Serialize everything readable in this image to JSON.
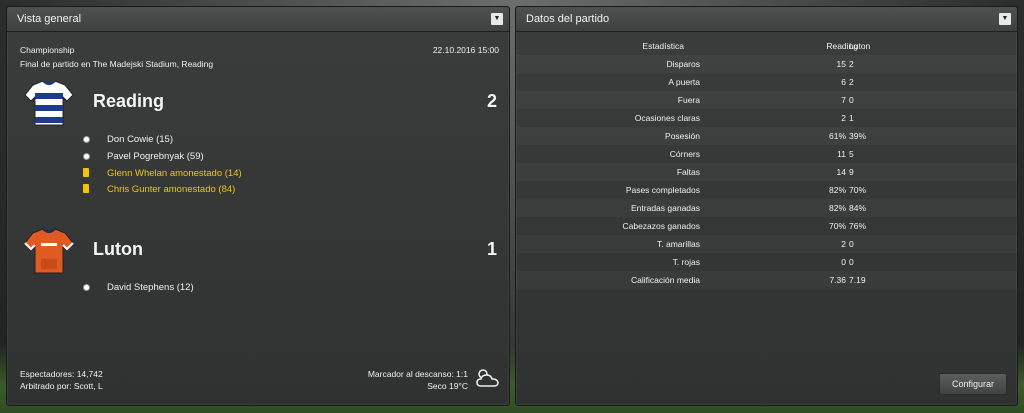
{
  "left_panel": {
    "title": "Vista general",
    "competition": "Championship",
    "date": "22.10.2016 15:00",
    "venue": "Final de partido en The Madejski Stadium, Reading",
    "home": {
      "name": "Reading",
      "score": "2",
      "kit_colors": {
        "primary": "#1e3a8a",
        "secondary": "#ffffff"
      },
      "events": [
        {
          "type": "goal",
          "text": "Don Cowie (15)"
        },
        {
          "type": "goal",
          "text": "Pavel Pogrebnyak (59)"
        },
        {
          "type": "yellow",
          "text": "Glenn Whelan amonestado (14)"
        },
        {
          "type": "yellow",
          "text": "Chris Gunter amonestado (84)"
        }
      ]
    },
    "away": {
      "name": "Luton",
      "score": "1",
      "kit_colors": {
        "primary": "#e05a22",
        "secondary": "#ffffff"
      },
      "events": [
        {
          "type": "goal",
          "text": "David Stephens (12)"
        }
      ]
    },
    "footer": {
      "attendance": "Espectadores: 14,742",
      "referee": "Arbitrado por: Scott, L",
      "halftime": "Marcador al descanso: 1:1",
      "weather": "Seco 19°C",
      "weather_icon": "cloud-sun-icon"
    }
  },
  "right_panel": {
    "title": "Datos del partido",
    "header": {
      "label": "Estadística",
      "home": "Reading",
      "away": "Luton"
    },
    "rows": [
      {
        "label": "Disparos",
        "home": "15",
        "away": "2"
      },
      {
        "label": "A puerta",
        "home": "6",
        "away": "2"
      },
      {
        "label": "Fuera",
        "home": "7",
        "away": "0"
      },
      {
        "label": "Ocasiones claras",
        "home": "2",
        "away": "1"
      },
      {
        "label": "Posesión",
        "home": "61%",
        "away": "39%"
      },
      {
        "label": "Córners",
        "home": "11",
        "away": "5"
      },
      {
        "label": "Faltas",
        "home": "14",
        "away": "9"
      },
      {
        "label": "Pases completados",
        "home": "82%",
        "away": "70%"
      },
      {
        "label": "Entradas ganadas",
        "home": "82%",
        "away": "84%"
      },
      {
        "label": "Cabezazos ganados",
        "home": "70%",
        "away": "76%"
      },
      {
        "label": "T. amarillas",
        "home": "2",
        "away": "0"
      },
      {
        "label": "T. rojas",
        "home": "0",
        "away": "0"
      },
      {
        "label": "Calificación media",
        "home": "7.36",
        "away": "7.19"
      }
    ],
    "configure_button": "Configurar"
  }
}
